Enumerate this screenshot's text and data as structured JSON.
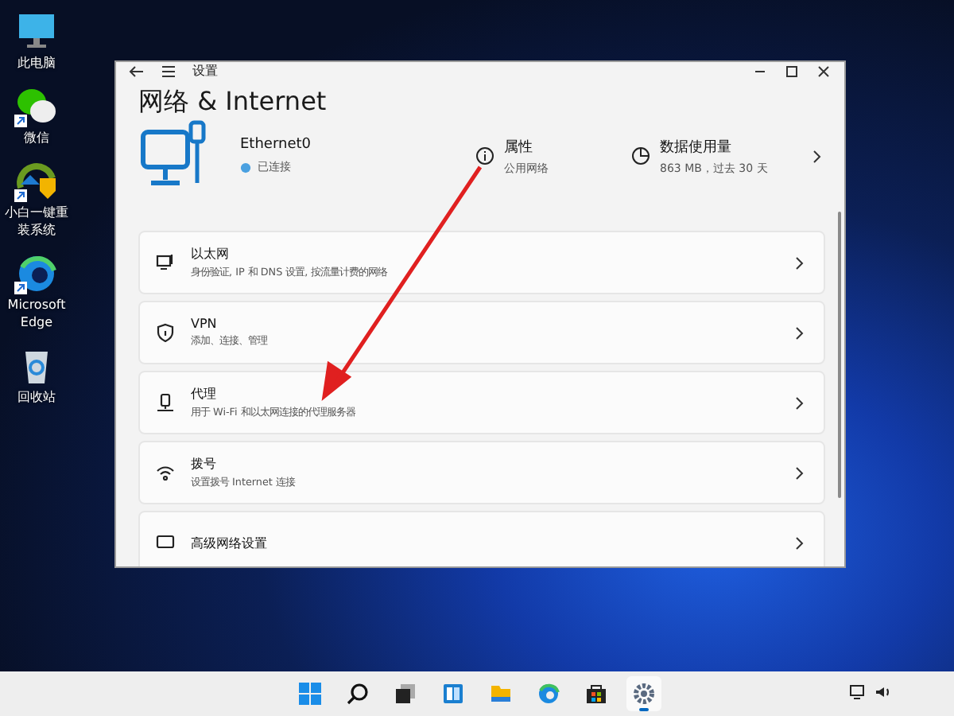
{
  "desktop_icons": [
    {
      "kind": "computer",
      "label": "此电脑"
    },
    {
      "kind": "wechat",
      "label": "微信",
      "shortcut": true
    },
    {
      "kind": "installer",
      "label": "小白一键重装系统",
      "shortcut": true
    },
    {
      "kind": "edge",
      "label": "Microsoft Edge",
      "shortcut": true
    },
    {
      "kind": "recycle",
      "label": "回收站"
    }
  ],
  "window": {
    "title": "设置",
    "heading": "网络 & Internet",
    "connection": {
      "name": "Ethernet0",
      "status": "已连接"
    },
    "properties": {
      "title": "属性",
      "subtitle": "公用网络"
    },
    "data_usage": {
      "title": "数据使用量",
      "subtitle": "863 MB，过去 30 天"
    },
    "items": [
      {
        "kind": "ethernet",
        "title": "以太网",
        "description": "身份验证, IP 和 DNS 设置, 按流量计费的网络"
      },
      {
        "kind": "vpn",
        "title": "VPN",
        "description": "添加、连接、管理"
      },
      {
        "kind": "proxy",
        "title": "代理",
        "description": "用于 Wi-Fi 和以太网连接的代理服务器"
      },
      {
        "kind": "dialup",
        "title": "拨号",
        "description": "设置拨号 Internet 连接"
      },
      {
        "kind": "advanced",
        "title": "高级网络设置"
      }
    ]
  },
  "taskbar": {
    "apps": [
      {
        "kind": "start",
        "selected": false
      },
      {
        "kind": "search",
        "selected": false
      },
      {
        "kind": "taskview",
        "selected": false
      },
      {
        "kind": "widgets",
        "selected": false
      },
      {
        "kind": "explorer",
        "selected": false
      },
      {
        "kind": "edge",
        "selected": false
      },
      {
        "kind": "store",
        "selected": false
      },
      {
        "kind": "settings",
        "selected": true
      }
    ]
  }
}
